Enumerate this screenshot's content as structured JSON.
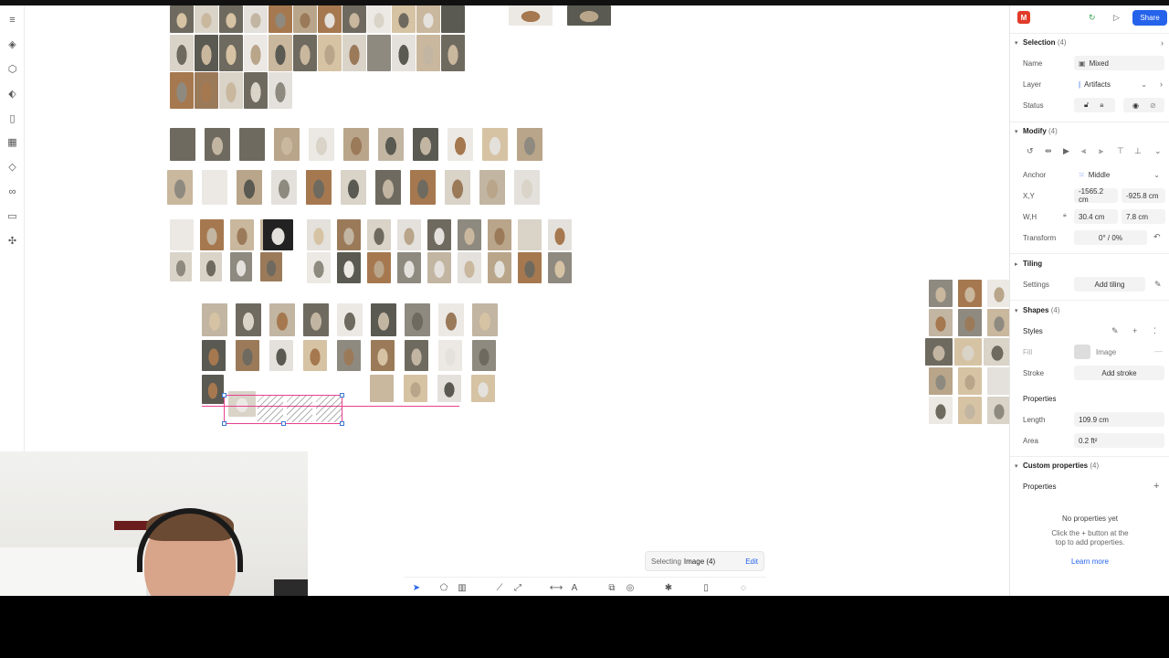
{
  "toolbar": {
    "avatar_initial": "M",
    "share_label": "Share"
  },
  "selection": {
    "title": "Selection",
    "count": "(4)",
    "name_label": "Name",
    "name_value": "Mixed",
    "layer_label": "Layer",
    "layer_value": "Artifacts",
    "status_label": "Status"
  },
  "modify": {
    "title": "Modify",
    "count": "(4)",
    "anchor_label": "Anchor",
    "anchor_value": "Middle",
    "xy_label": "X,Y",
    "x_value": "-1565.2 cm",
    "y_value": "-925.8 cm",
    "wh_label": "W,H",
    "w_value": "30.4 cm",
    "h_value": "7.8 cm",
    "transform_label": "Transform",
    "transform_value": "0° / 0%"
  },
  "tiling": {
    "title": "Tiling",
    "settings_label": "Settings",
    "add_label": "Add tiling"
  },
  "shapes": {
    "title": "Shapes",
    "count": "(4)",
    "styles_label": "Styles",
    "fill_label": "Fill",
    "fill_value": "Image",
    "stroke_label": "Stroke",
    "stroke_add": "Add stroke",
    "properties_label": "Properties",
    "length_label": "Length",
    "length_value": "109.9 cm",
    "area_label": "Area",
    "area_value": "0.2 ft²"
  },
  "custom": {
    "title": "Custom properties",
    "count": "(4)",
    "properties_label": "Properties",
    "empty_title": "No properties yet",
    "empty_hint_1": "Click the + button at the",
    "empty_hint_2": "top to add properties.",
    "learn_more": "Learn more"
  },
  "bottom_bar": {
    "selecting_label": "Selecting",
    "selecting_object": "Image (4)",
    "edit_label": "Edit"
  },
  "colors": {
    "accent": "#2563eb",
    "selection": "#e7408f",
    "brand": "#e23b2a"
  }
}
